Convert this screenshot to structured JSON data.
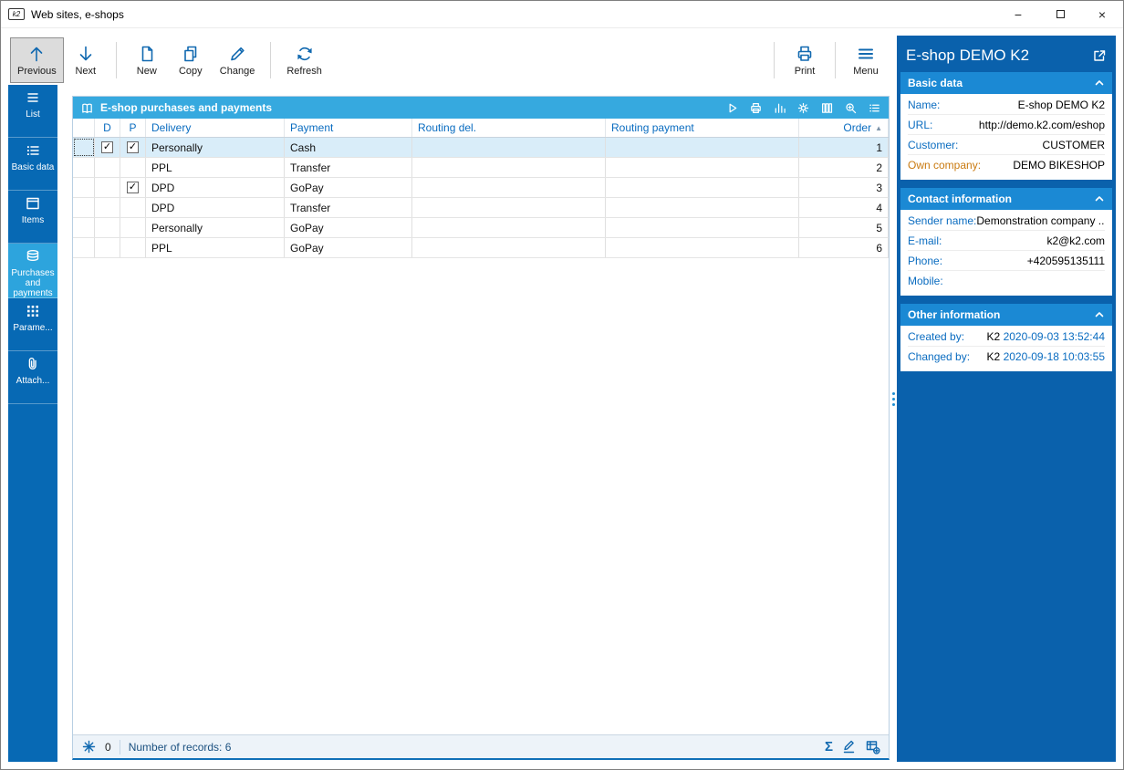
{
  "window": {
    "title": "Web sites, e-shops",
    "app_icon_text": "k2"
  },
  "toolbar": {
    "previous": "Previous",
    "next": "Next",
    "new": "New",
    "copy": "Copy",
    "change": "Change",
    "refresh": "Refresh",
    "print": "Print",
    "menu": "Menu"
  },
  "sidebar": {
    "items": [
      {
        "label": "List",
        "active": false
      },
      {
        "label": "Basic data",
        "active": false
      },
      {
        "label": "Items",
        "active": false
      },
      {
        "label": "Purchases and payments",
        "active": true
      },
      {
        "label": "Parame...",
        "active": false
      },
      {
        "label": "Attach...",
        "active": false
      }
    ]
  },
  "grid": {
    "title": "E-shop purchases and payments",
    "columns": {
      "d": "D",
      "p": "P",
      "delivery": "Delivery",
      "payment": "Payment",
      "routing_del": "Routing del.",
      "routing_payment": "Routing payment",
      "order": "Order"
    },
    "sort": {
      "column": "Order",
      "direction": "asc"
    },
    "rows": [
      {
        "d": true,
        "p": true,
        "delivery": "Personally",
        "payment": "Cash",
        "routing_del": "",
        "routing_payment": "",
        "order": "1",
        "selected": true
      },
      {
        "d": false,
        "p": false,
        "delivery": "PPL",
        "payment": "Transfer",
        "routing_del": "",
        "routing_payment": "",
        "order": "2",
        "selected": false
      },
      {
        "d": false,
        "p": true,
        "delivery": "DPD",
        "payment": "GoPay",
        "routing_del": "",
        "routing_payment": "",
        "order": "3",
        "selected": false
      },
      {
        "d": false,
        "p": false,
        "delivery": "DPD",
        "payment": "Transfer",
        "routing_del": "",
        "routing_payment": "",
        "order": "4",
        "selected": false
      },
      {
        "d": false,
        "p": false,
        "delivery": "Personally",
        "payment": "GoPay",
        "routing_del": "",
        "routing_payment": "",
        "order": "5",
        "selected": false
      },
      {
        "d": false,
        "p": false,
        "delivery": "PPL",
        "payment": "GoPay",
        "routing_del": "",
        "routing_payment": "",
        "order": "6",
        "selected": false
      }
    ],
    "status": {
      "flower_count": "0",
      "records": "Number of records: 6"
    }
  },
  "right_panel": {
    "title": "E-shop DEMO K2",
    "basic_data": {
      "header": "Basic data",
      "rows": [
        {
          "label": "Name:",
          "value": "E-shop DEMO K2"
        },
        {
          "label": "URL:",
          "value": "http://demo.k2.com/eshop"
        },
        {
          "label": "Customer:",
          "value": "CUSTOMER"
        },
        {
          "label": "Own company:",
          "value": "DEMO BIKESHOP"
        }
      ]
    },
    "contact": {
      "header": "Contact information",
      "rows": [
        {
          "label": "Sender name:",
          "value": "Demonstration company ..."
        },
        {
          "label": "E-mail:",
          "value": "k2@k2.com"
        },
        {
          "label": "Phone:",
          "value": "+420595135111"
        },
        {
          "label": "Mobile:",
          "value": ""
        }
      ]
    },
    "other": {
      "header": "Other information",
      "rows": [
        {
          "label": "Created by:",
          "user": "K2",
          "time": "2020-09-03 13:52:44"
        },
        {
          "label": "Changed by:",
          "user": "K2",
          "time": "2020-09-18 10:03:55"
        }
      ]
    }
  },
  "colors": {
    "sidebar_blue": "#0769b4",
    "active_blue": "#2da4dd",
    "panel_header_blue": "#36a9df",
    "section_header_blue": "#1b89d4",
    "right_panel_blue": "#0a61ac",
    "label_blue": "#0a6cc0",
    "accent_orange": "#c97a10",
    "selected_row": "#d9edf9"
  }
}
